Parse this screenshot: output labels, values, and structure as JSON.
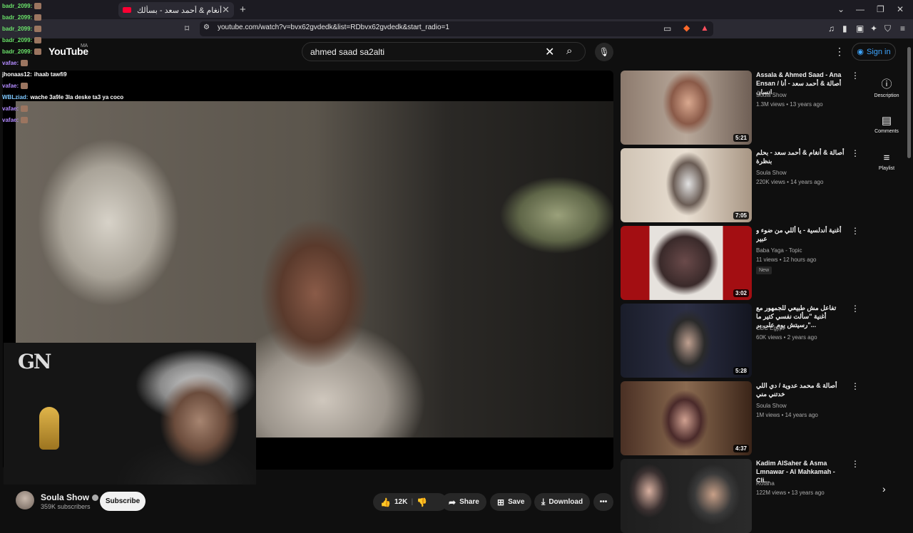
{
  "browser": {
    "tab_title": "أصالة و أنغام & أحمد سعد - بسألك",
    "new_tab": "+",
    "url": "youtube.com/watch?v=bvx62gvdedk&list=RDbvx62gvdedk&start_radio=1",
    "window_controls": [
      "⌄",
      "—",
      "❐",
      "✕"
    ]
  },
  "youtube": {
    "logo": "YouTube",
    "region": "MA",
    "search_value": "ahmed saad sa2alti",
    "sign_in": "Sign in"
  },
  "chat": [
    {
      "name": "badr_2099:",
      "msg": "",
      "color": "green"
    },
    {
      "name": "badr_2099:",
      "msg": "",
      "color": "green"
    },
    {
      "name": "badr_2099:",
      "msg": "",
      "color": "green"
    },
    {
      "name": "badr_2099:",
      "msg": "",
      "color": "green"
    },
    {
      "name": "badr_2099:",
      "msg": "",
      "color": "green"
    },
    {
      "name": "vafae:",
      "msg": "",
      "color": "purple"
    },
    {
      "name": "jhonaas12:",
      "msg": "ihaab tawfi9",
      "color": "white"
    },
    {
      "name": "vafae:",
      "msg": "",
      "color": "purple"
    },
    {
      "name": "WBLziad:",
      "msg": "wache 3a9le 3la deske ta3 ya coco",
      "color": "blue"
    },
    {
      "name": "vafae:",
      "msg": "",
      "color": "purple"
    },
    {
      "name": "vafae:",
      "msg": "",
      "color": "purple"
    }
  ],
  "webcam": {
    "logo": "GN"
  },
  "channel": {
    "name": "Soula Show",
    "subscribers": "359K subscribers",
    "subscribe": "Subscribe"
  },
  "actions": {
    "likes": "12K",
    "share": "Share",
    "save": "Save",
    "download": "Download",
    "more": "•••"
  },
  "recommendations": [
    {
      "title": "Assala & Ahmed Saad - Ana Ensan / أصالة & أحمد سعد - أنا انسان",
      "channel": "Soula Show",
      "meta": "1.3M views • 13 years ago",
      "duration": "5:21"
    },
    {
      "title": "أصالة & أنغام & أحمد سعد - بحلم بنظرة",
      "channel": "Soula Show",
      "meta": "220K views • 14 years ago",
      "duration": "7:05"
    },
    {
      "title": "أغنية أندلسية - يا أللي من ضوء و عبير",
      "channel": "Baba Yaga - Topic",
      "meta": "11 views • 12 hours ago",
      "badge": "New",
      "duration": "3:02"
    },
    {
      "title": "تفاعل مش طبيعي للجمهور مع أغنية \"سألت نفسي كتير ما رسيتش يوم على بر\"...",
      "channel": "CBC Egypt",
      "meta": "60K views • 2 years ago",
      "duration": "5:28"
    },
    {
      "title": "أصالة & محمد عدوية / دي اللي خدتني مني",
      "channel": "Soula Show",
      "meta": "1M views • 14 years ago",
      "duration": "4:37"
    },
    {
      "title": "Kadim AlSaher & Asma Lmnawar - Al Mahkamah - Cli...",
      "channel": "Rotana",
      "meta": "122M views • 13 years ago",
      "duration": ""
    }
  ],
  "rail": {
    "description": "Description",
    "comments": "Comments",
    "playlist": "Playlist"
  }
}
